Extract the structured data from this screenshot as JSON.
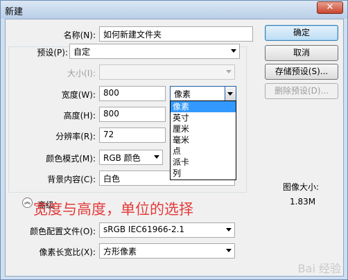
{
  "window": {
    "title": "新建",
    "close_glyph": "✕"
  },
  "form": {
    "name_label": "名称(N):",
    "name_value": "如何新建文件夹",
    "preset_label": "预设(P):",
    "preset_value": "自定",
    "size_label": "大小(I):",
    "size_value": "",
    "width_label": "宽度(W):",
    "width_value": "800",
    "width_unit": "像素",
    "height_label": "高度(H):",
    "height_value": "800",
    "resolution_label": "分辨率(R):",
    "resolution_value": "72",
    "color_mode_label": "颜色模式(M):",
    "color_mode_value": "RGB 颜色",
    "background_label": "背景内容(C):",
    "background_value": "白色",
    "advanced_label": "高级",
    "color_profile_label": "颜色配置文件(O):",
    "color_profile_value": "sRGB IEC61966-2.1",
    "pixel_aspect_label": "像素长宽比(X):",
    "pixel_aspect_value": "方形像素"
  },
  "unit_dropdown": {
    "options": [
      "像素",
      "英寸",
      "厘米",
      "毫米",
      "点",
      "派卡",
      "列"
    ],
    "selected_index": 0
  },
  "buttons": {
    "ok": "确定",
    "cancel": "取消",
    "save_preset": "存储预设(S)...",
    "delete_preset": "删除预设(D)..."
  },
  "image_size": {
    "label": "图像大小:",
    "value": "1.83M"
  },
  "annotation": "宽度与高度，单位的选择",
  "watermark": "Bai 经验"
}
